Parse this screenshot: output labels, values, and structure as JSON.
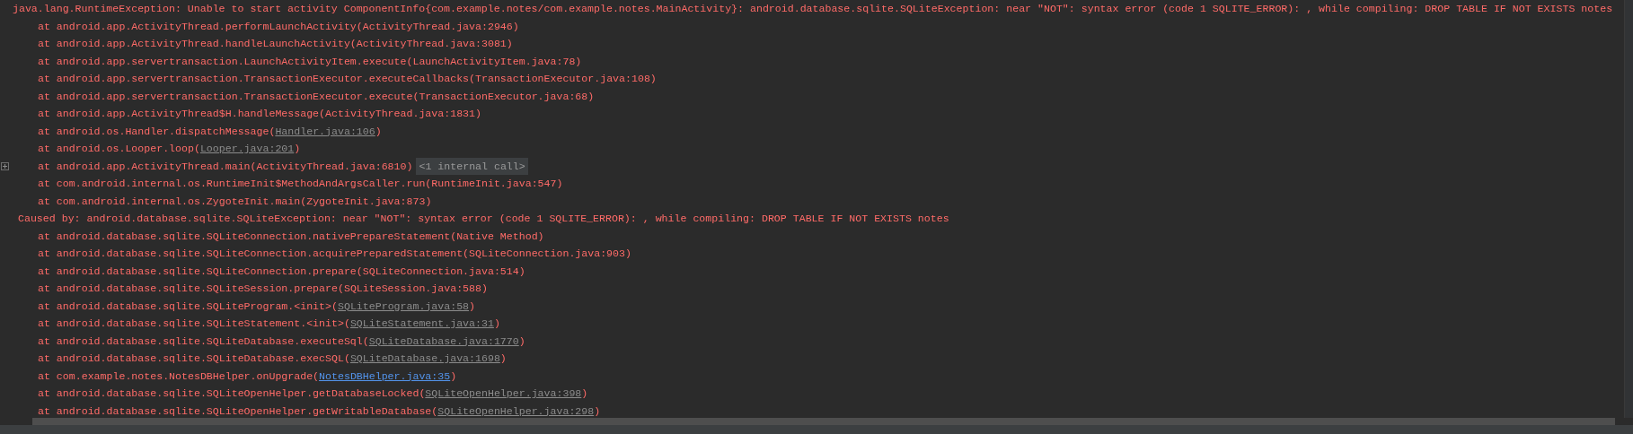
{
  "log_lines": [
    {
      "kind": "exception",
      "text": "java.lang.RuntimeException: Unable to start activity ComponentInfo{com.example.notes/com.example.notes.MainActivity}: android.database.sqlite.SQLiteException: near \"NOT\": syntax error (code 1 SQLITE_ERROR): , while compiling: DROP TABLE IF NOT EXISTS notes"
    },
    {
      "kind": "frame",
      "method": "at android.app.ActivityThread.performLaunchActivity(",
      "location": "ActivityThread.java:2946",
      "close": ")"
    },
    {
      "kind": "frame",
      "method": "at android.app.ActivityThread.handleLaunchActivity(",
      "location": "ActivityThread.java:3081",
      "close": ")"
    },
    {
      "kind": "frame",
      "method": "at android.app.servertransaction.LaunchActivityItem.execute(",
      "location": "LaunchActivityItem.java:78",
      "close": ")"
    },
    {
      "kind": "frame",
      "method": "at android.app.servertransaction.TransactionExecutor.executeCallbacks(",
      "location": "TransactionExecutor.java:108",
      "close": ")"
    },
    {
      "kind": "frame",
      "method": "at android.app.servertransaction.TransactionExecutor.execute(",
      "location": "TransactionExecutor.java:68",
      "close": ")"
    },
    {
      "kind": "frame",
      "method": "at android.app.ActivityThread$H.handleMessage(",
      "location": "ActivityThread.java:1831",
      "close": ")"
    },
    {
      "kind": "library_frame",
      "method": "at android.os.Handler.dispatchMessage(",
      "location": "Handler.java:106",
      "close": ")"
    },
    {
      "kind": "library_frame",
      "method": "at android.os.Looper.loop(",
      "location": "Looper.java:201",
      "close": ")"
    },
    {
      "kind": "frame",
      "method": "at android.app.ActivityThread.main(",
      "location": "ActivityThread.java:6810",
      "close": ")",
      "folded": "<1 internal call>"
    },
    {
      "kind": "frame",
      "method": "at com.android.internal.os.RuntimeInit$MethodAndArgsCaller.run(",
      "location": "RuntimeInit.java:547",
      "close": ")"
    },
    {
      "kind": "frame",
      "method": "at com.android.internal.os.ZygoteInit.main(",
      "location": "ZygoteInit.java:873",
      "close": ")"
    },
    {
      "kind": "caused",
      "text": "Caused by: android.database.sqlite.SQLiteException: near \"NOT\": syntax error (code 1 SQLITE_ERROR): , while compiling: DROP TABLE IF NOT EXISTS notes"
    },
    {
      "kind": "frame",
      "method": "at android.database.sqlite.SQLiteConnection.nativePrepareStatement(",
      "location": "Native Method",
      "close": ")"
    },
    {
      "kind": "frame",
      "method": "at android.database.sqlite.SQLiteConnection.acquirePreparedStatement(",
      "location": "SQLiteConnection.java:903",
      "close": ")"
    },
    {
      "kind": "frame",
      "method": "at android.database.sqlite.SQLiteConnection.prepare(",
      "location": "SQLiteConnection.java:514",
      "close": ")"
    },
    {
      "kind": "frame",
      "method": "at android.database.sqlite.SQLiteSession.prepare(",
      "location": "SQLiteSession.java:588",
      "close": ")"
    },
    {
      "kind": "library_frame",
      "method": "at android.database.sqlite.SQLiteProgram.<init>(",
      "location": "SQLiteProgram.java:58",
      "close": ")"
    },
    {
      "kind": "library_frame",
      "method": "at android.database.sqlite.SQLiteStatement.<init>(",
      "location": "SQLiteStatement.java:31",
      "close": ")"
    },
    {
      "kind": "library_frame",
      "method": "at android.database.sqlite.SQLiteDatabase.executeSql(",
      "location": "SQLiteDatabase.java:1770",
      "close": ")"
    },
    {
      "kind": "library_frame",
      "method": "at android.database.sqlite.SQLiteDatabase.execSQL(",
      "location": "SQLiteDatabase.java:1698",
      "close": ")"
    },
    {
      "kind": "source_frame",
      "method": "at com.example.notes.NotesDBHelper.onUpgrade(",
      "location": "NotesDBHelper.java:35",
      "close": ")"
    },
    {
      "kind": "library_frame",
      "method": "at android.database.sqlite.SQLiteOpenHelper.getDatabaseLocked(",
      "location": "SQLiteOpenHelper.java:398",
      "close": ")"
    },
    {
      "kind": "library_frame",
      "method": "at android.database.sqlite.SQLiteOpenHelper.getWritableDatabase(",
      "location": "SQLiteOpenHelper.java:298",
      "close": ")"
    }
  ]
}
